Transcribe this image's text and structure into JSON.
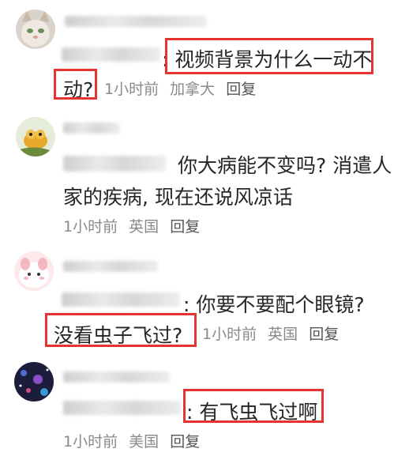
{
  "comments": [
    {
      "text_line1": ": 视频背景为什么一动不",
      "text_line2": "动?",
      "time": "1小时前",
      "location": "加拿大",
      "reply": "回复"
    },
    {
      "text_line1": "你大病能不变吗? 消遣人",
      "text_line2": "家的疾病, 现在还说风凉话",
      "time": "1小时前",
      "location": "英国",
      "reply": "回复"
    },
    {
      "text_line1": ": 你要不要配个眼镜?",
      "text_line2": "没看虫子飞过?",
      "time": "1小时前",
      "location": "英国",
      "reply": "回复"
    },
    {
      "text_line1": ": 有飞虫飞过啊",
      "time": "1小时前",
      "location": "美国",
      "reply": "回复"
    }
  ],
  "colors": {
    "highlight": "#e5342f",
    "meta": "#8a8a8a"
  }
}
